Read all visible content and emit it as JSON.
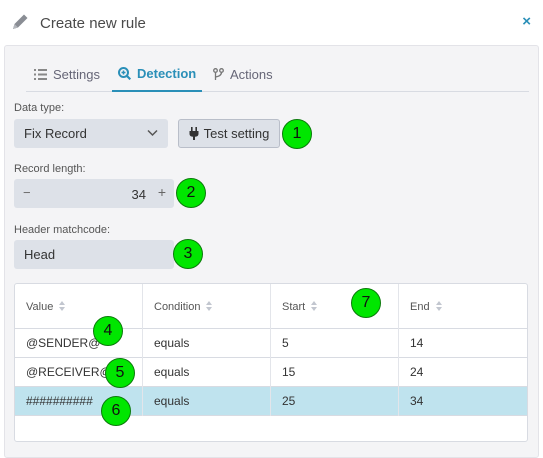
{
  "dialog": {
    "title": "Create new rule",
    "close_symbol": "×"
  },
  "tabs": [
    {
      "label": "Settings",
      "icon": "list-icon",
      "active": false
    },
    {
      "label": "Detection",
      "icon": "search-plus-icon",
      "active": true
    },
    {
      "label": "Actions",
      "icon": "branch-icon",
      "active": false
    }
  ],
  "data_type": {
    "label": "Data type:",
    "value": "Fix Record"
  },
  "test_button": {
    "label": "Test setting",
    "icon": "plug-icon"
  },
  "record_length": {
    "label": "Record length:",
    "value": "34",
    "minus": "−",
    "plus": "+"
  },
  "header_matchcode": {
    "label": "Header matchcode:",
    "value": "Head"
  },
  "table": {
    "columns": [
      "Value",
      "Condition",
      "Start",
      "End"
    ],
    "rows": [
      [
        "@SENDER@",
        "equals",
        "5",
        "14"
      ],
      [
        "@RECEIVER@",
        "equals",
        "15",
        "24"
      ],
      [
        "##########",
        "equals",
        "25",
        "34"
      ]
    ],
    "selected_row": 2
  },
  "annotations": [
    "1",
    "2",
    "3",
    "4",
    "5",
    "6",
    "7"
  ],
  "colors": {
    "accent": "#2a8fb8",
    "badge": "#00e600",
    "selected_row": "#bfe3ee",
    "field_bg": "#dde1e8"
  }
}
